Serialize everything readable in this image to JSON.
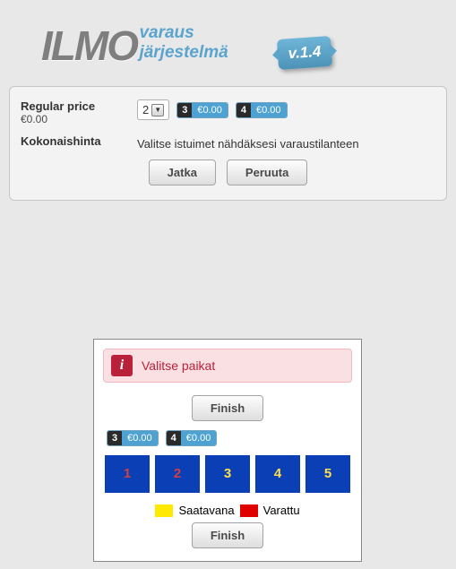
{
  "logo": {
    "main": "ILMO",
    "sub1": "varaus",
    "sub2": "järjestelmä",
    "badge": "v.1.4"
  },
  "panel": {
    "price_label": "Regular price",
    "price_value": "€0.00",
    "qty": "2",
    "chips": [
      {
        "n": "3",
        "p": "€0.00"
      },
      {
        "n": "4",
        "p": "€0.00"
      }
    ],
    "total_label": "Kokonaishinta",
    "total_msg": "Valitse istuimet nähdäksesi varaustilanteen",
    "btn_continue": "Jatka",
    "btn_cancel": "Peruuta"
  },
  "popup": {
    "info_icon": "i",
    "alert": "Valitse paikat",
    "finish": "Finish",
    "chips": [
      {
        "n": "3",
        "p": "€0.00"
      },
      {
        "n": "4",
        "p": "€0.00"
      }
    ],
    "seats": [
      {
        "num": "1",
        "reserved": true
      },
      {
        "num": "2",
        "reserved": true
      },
      {
        "num": "3",
        "reserved": false
      },
      {
        "num": "4",
        "reserved": false
      },
      {
        "num": "5",
        "reserved": false
      }
    ],
    "legend_avail": "Saatavana",
    "legend_res": "Varattu"
  }
}
